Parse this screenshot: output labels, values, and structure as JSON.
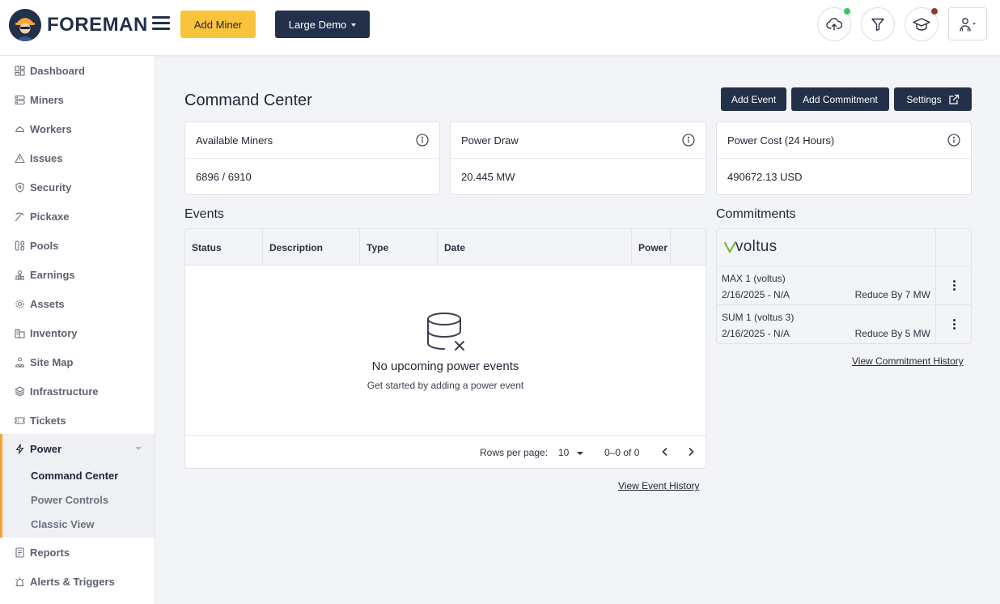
{
  "header": {
    "brand": "FOREMAN",
    "add_miner": "Add Miner",
    "workspace": "Large Demo",
    "status_colors": {
      "upload": "#3cc46a",
      "learn": "#8c3a35"
    }
  },
  "sidebar": {
    "items": [
      {
        "label": "Dashboard",
        "icon": "dashboard-icon"
      },
      {
        "label": "Miners",
        "icon": "server-icon"
      },
      {
        "label": "Workers",
        "icon": "helmet-icon"
      },
      {
        "label": "Issues",
        "icon": "warning-icon"
      },
      {
        "label": "Security",
        "icon": "shield-icon"
      },
      {
        "label": "Pickaxe",
        "icon": "pickaxe-icon"
      },
      {
        "label": "Pools",
        "icon": "pools-icon"
      },
      {
        "label": "Earnings",
        "icon": "earnings-icon"
      },
      {
        "label": "Assets",
        "icon": "gear-icon"
      },
      {
        "label": "Inventory",
        "icon": "inventory-icon"
      },
      {
        "label": "Site Map",
        "icon": "sitemap-icon"
      },
      {
        "label": "Infrastructure",
        "icon": "layers-icon"
      },
      {
        "label": "Tickets",
        "icon": "ticket-icon"
      }
    ],
    "power": {
      "label": "Power",
      "sub": [
        "Command Center",
        "Power Controls",
        "Classic View"
      ]
    },
    "bottom_items": [
      {
        "label": "Reports",
        "icon": "report-icon"
      },
      {
        "label": "Alerts & Triggers",
        "icon": "alarm-icon"
      }
    ]
  },
  "main": {
    "title": "Command Center",
    "actions": {
      "add_event": "Add Event",
      "add_commitment": "Add Commitment",
      "settings": "Settings"
    },
    "cards": [
      {
        "label": "Available Miners",
        "value": "6896 / 6910"
      },
      {
        "label": "Power Draw",
        "value": "20.445 MW"
      },
      {
        "label": "Power Cost (24 Hours)",
        "value": "490672.13 USD"
      }
    ],
    "events": {
      "title": "Events",
      "columns": [
        "Status",
        "Description",
        "Type",
        "Date",
        "Power"
      ],
      "empty_title": "No upcoming power events",
      "empty_sub": "Get started by adding a power event",
      "rows_per_page_label": "Rows per page:",
      "rows_per_page": "10",
      "range": "0–0 of 0",
      "history": "View Event History"
    },
    "commitments": {
      "title": "Commitments",
      "provider": "voltus",
      "rows": [
        {
          "name": "MAX 1 (voltus)",
          "date": "2/16/2025 - N/A",
          "reduce": "Reduce By 7 MW"
        },
        {
          "name": "SUM 1 (voltus 3)",
          "date": "2/16/2025 - N/A",
          "reduce": "Reduce By 5 MW"
        }
      ],
      "history": "View Commitment History"
    }
  }
}
